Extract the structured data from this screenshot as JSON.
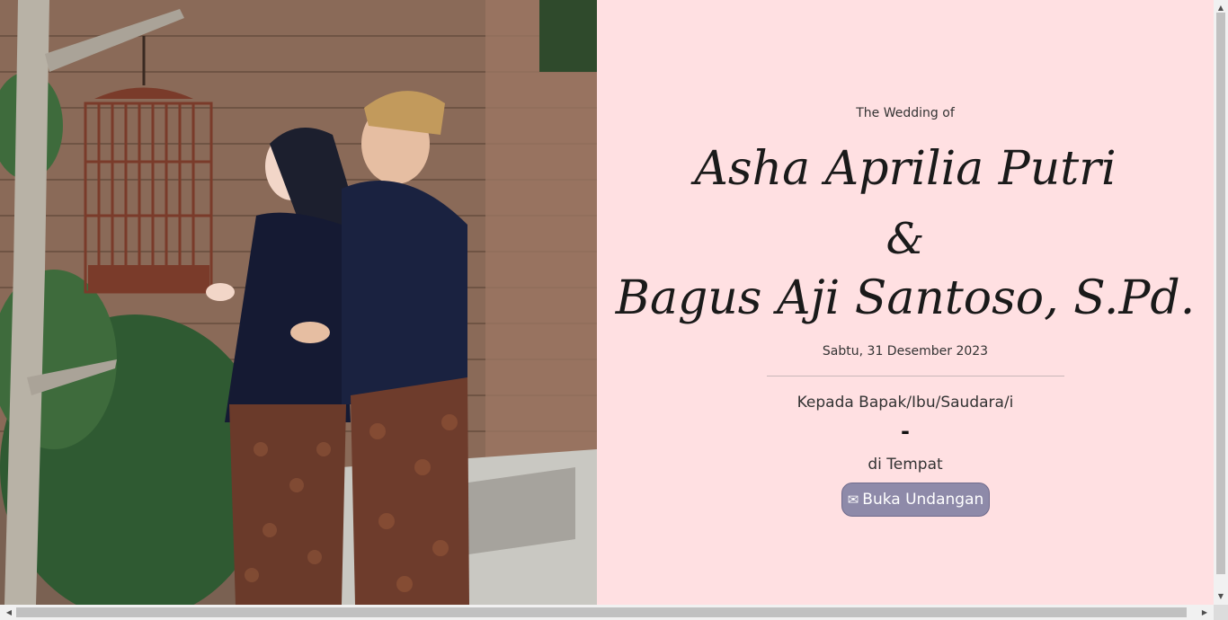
{
  "hero": {
    "subtitle": "The Wedding of",
    "bride": "Asha Aprilia Putri",
    "ampersand": "&",
    "groom": "Bagus Aji Santoso, S.Pd.",
    "date": "Sabtu, 31 Desember 2023"
  },
  "invite": {
    "greeting": "Kepada Bapak/Ibu/Saudara/i",
    "guest_name": "-",
    "place": "di Tempat",
    "button_icon": "envelope-icon",
    "button_glyph": "✉",
    "button_label": "Buka Undangan"
  },
  "colors": {
    "panel_bg": "#ffe0e2",
    "button_bg": "#8e8aa9"
  }
}
